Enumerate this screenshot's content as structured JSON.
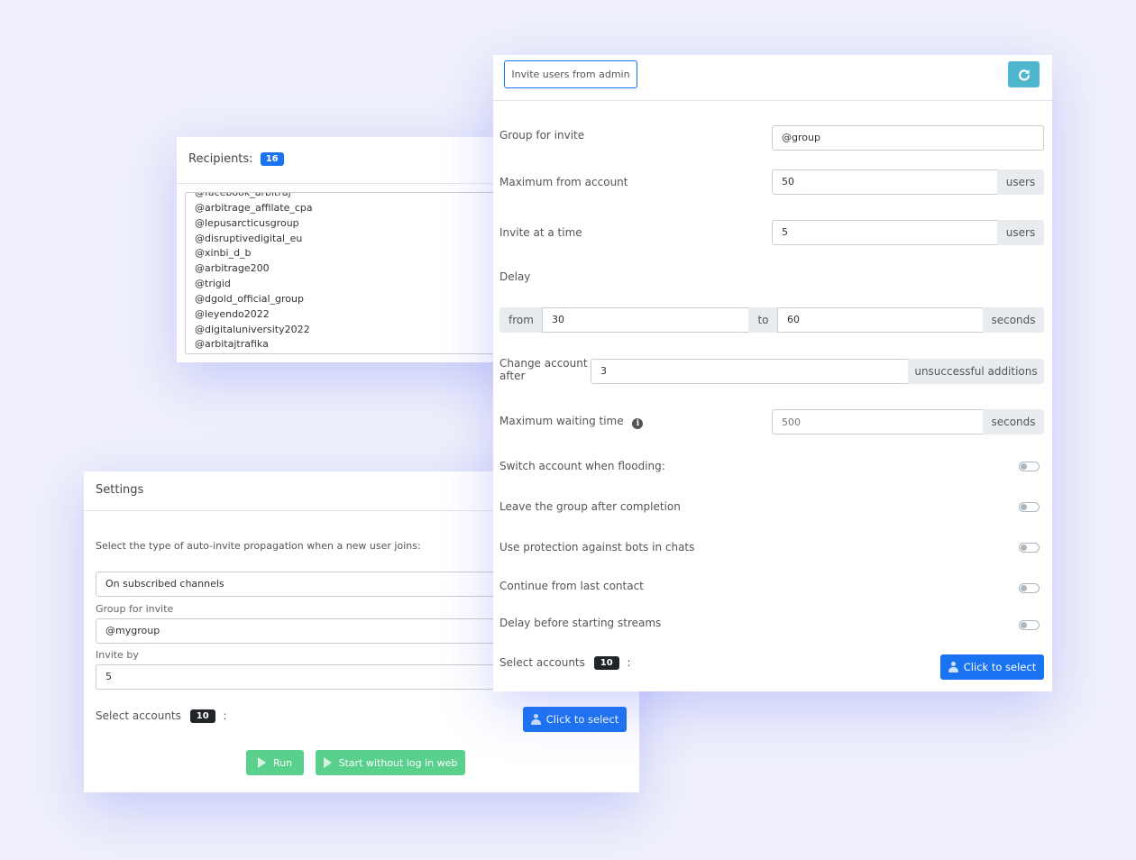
{
  "recipients": {
    "label": "Recipients:",
    "count": "16",
    "items": [
      "@facebook_arbitraj",
      "@arbitrage_affilate_cpa",
      "@lepusarcticusgroup",
      "@disruptivedigital_eu",
      "@xinbi_d_b",
      "@arbitrage200",
      "@trigid",
      "@dgold_official_group",
      "@leyendo2022",
      "@digitaluniversity2022",
      "@arbitajtrafika"
    ]
  },
  "settings": {
    "title": "Settings",
    "propagation_prompt": "Select the type of auto-invite propagation when a new user joins:",
    "propagation_value": "On subscribed channels",
    "group_label": "Group for invite",
    "group_value": "@mygroup",
    "invite_by_label": "Invite by",
    "invite_by_value": "5",
    "select_accounts_label": "Select accounts",
    "select_accounts_count": "10",
    "colon": ":",
    "click_to_select": "Click to select",
    "run": "Run",
    "start_without_log": "Start without log in web"
  },
  "invite": {
    "tab_label": "Invite users from admin",
    "group_label": "Group for invite",
    "group_value": "@group",
    "max_from_account_label": "Maximum from account",
    "max_from_account_value": "50",
    "users_unit": "users",
    "invite_at_time_label": "Invite at a time",
    "invite_at_time_value": "5",
    "delay_label": "Delay",
    "from_label": "from",
    "from_value": "30",
    "to_label": "to",
    "to_value": "60",
    "seconds_unit": "seconds",
    "change_account_label": "Change account after",
    "change_account_value": "3",
    "unsuccessful_unit": "unsuccessful additions",
    "max_wait_label": "Maximum waiting time",
    "max_wait_placeholder": "500",
    "switch_flooding_label": "Switch account when flooding:",
    "leave_group_label": "Leave the group after completion",
    "bot_protection_label": "Use protection against bots in chats",
    "continue_label": "Continue from last contact",
    "delay_streams_label": "Delay before starting streams",
    "toggles": {
      "switch_flooding": false,
      "leave_group": false,
      "bot_protection": false,
      "continue": false,
      "delay_streams": false
    },
    "select_accounts_label": "Select accounts",
    "select_accounts_count": "10",
    "colon": ":",
    "click_to_select": "Click to select"
  }
}
